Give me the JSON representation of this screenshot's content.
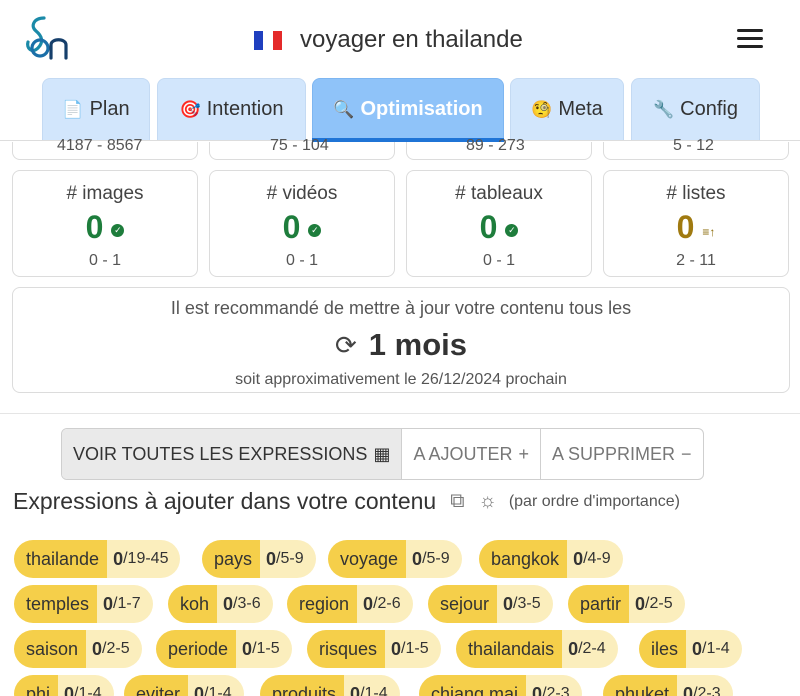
{
  "header": {
    "title": "voyager en thailande",
    "flag_colors": [
      "#1f3fbf",
      "#ffffff",
      "#e42a2a"
    ],
    "menu_icon": "hamburger-icon"
  },
  "tabs": [
    {
      "icon": "📄",
      "label": "Plan"
    },
    {
      "icon": "🎯",
      "label": "Intention"
    },
    {
      "icon": "🔍",
      "label": "Optimisation",
      "active": true
    },
    {
      "icon": "🧐",
      "label": "Meta"
    },
    {
      "icon": "🔧",
      "label": "Config"
    }
  ],
  "cut_ranges": [
    "4187 - 8567",
    "75 - 104",
    "89 - 273",
    "5 - 12"
  ],
  "metrics": [
    {
      "label": "# images",
      "value": "0",
      "range": "0 - 1",
      "status": "ok",
      "color": "#1e7d3c"
    },
    {
      "label": "# vidéos",
      "value": "0",
      "range": "0 - 1",
      "status": "ok",
      "color": "#1e7d3c"
    },
    {
      "label": "# tableaux",
      "value": "0",
      "range": "0 - 1",
      "status": "ok",
      "color": "#1e7d3c"
    },
    {
      "label": "# listes",
      "value": "0",
      "range": "2 - 11",
      "status": "low",
      "color": "#a07a10"
    }
  ],
  "update": {
    "text": "Il est recommandé de mettre à jour votre contenu tous les",
    "value": "1 mois",
    "sub": "soit approximativement le 26/12/2024 prochain"
  },
  "buttons": {
    "all": "VOIR TOUTES LES EXPRESSIONS",
    "add": "A AJOUTER",
    "remove": "A SUPPRIMER"
  },
  "section": {
    "title": "Expressions à ajouter dans votre contenu",
    "note": "(par ordre d'importance)"
  },
  "expressions": [
    {
      "word": "thailande",
      "count": "0",
      "range": "/19-45"
    },
    {
      "word": "pays",
      "count": "0",
      "range": "/5-9"
    },
    {
      "word": "voyage",
      "count": "0",
      "range": "/5-9"
    },
    {
      "word": "bangkok",
      "count": "0",
      "range": "/4-9"
    },
    {
      "word": "temples",
      "count": "0",
      "range": "/1-7"
    },
    {
      "word": "koh",
      "count": "0",
      "range": "/3-6"
    },
    {
      "word": "region",
      "count": "0",
      "range": "/2-6"
    },
    {
      "word": "sejour",
      "count": "0",
      "range": "/3-5"
    },
    {
      "word": "partir",
      "count": "0",
      "range": "/2-5"
    },
    {
      "word": "saison",
      "count": "0",
      "range": "/2-5"
    },
    {
      "word": "periode",
      "count": "0",
      "range": "/1-5"
    },
    {
      "word": "risques",
      "count": "0",
      "range": "/1-5"
    },
    {
      "word": "thailandais",
      "count": "0",
      "range": "/2-4"
    },
    {
      "word": "iles",
      "count": "0",
      "range": "/1-4"
    },
    {
      "word": "phi",
      "count": "0",
      "range": "/1-4"
    },
    {
      "word": "eviter",
      "count": "0",
      "range": "/1-4"
    },
    {
      "word": "produits",
      "count": "0",
      "range": "/1-4"
    },
    {
      "word": "chiang mai",
      "count": "0",
      "range": "/2-3"
    },
    {
      "word": "phuket",
      "count": "0",
      "range": "/2-3"
    }
  ]
}
